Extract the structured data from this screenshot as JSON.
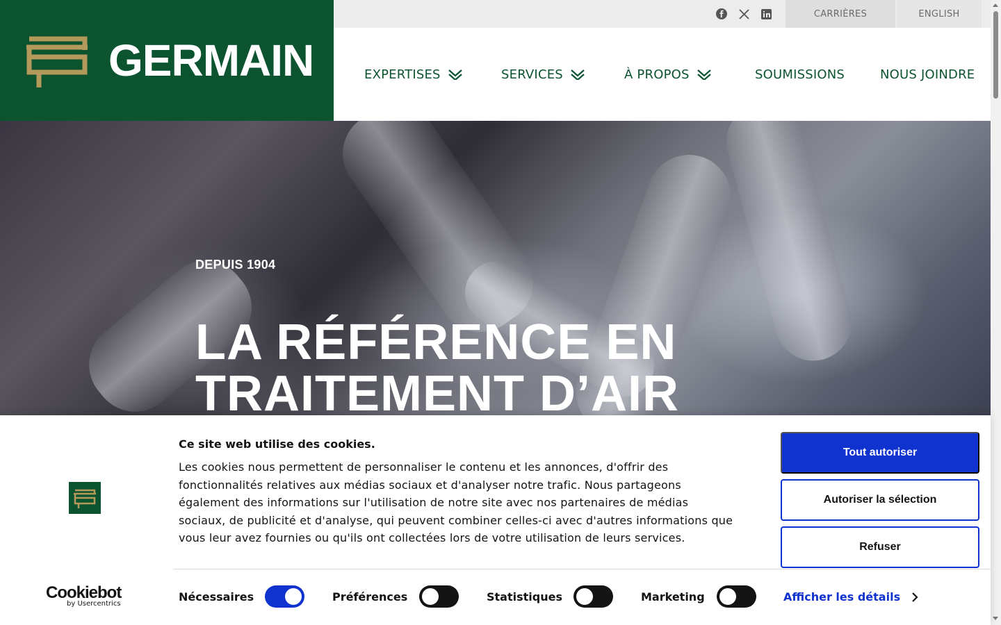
{
  "brand": {
    "name": "GERMAIN",
    "colors": {
      "green": "#0c5330",
      "gold": "#b49a5a",
      "cookie_blue": "#1032cf"
    }
  },
  "topbar": {
    "social": [
      "facebook-icon",
      "x-icon",
      "linkedin-icon"
    ],
    "careers": "CARRIÈRES",
    "language": "ENGLISH"
  },
  "nav": {
    "items": [
      {
        "label": "EXPERTISES",
        "has_dropdown": true
      },
      {
        "label": "SERVICES",
        "has_dropdown": true
      },
      {
        "label": "À PROPOS",
        "has_dropdown": true
      },
      {
        "label": "SOUMISSIONS",
        "has_dropdown": false
      },
      {
        "label": "NOUS JOINDRE",
        "has_dropdown": false
      }
    ]
  },
  "hero": {
    "eyebrow": "DEPUIS 1904",
    "title_line1": "LA RÉFÉRENCE EN",
    "title_line2": "TRAITEMENT D’AIR"
  },
  "cookie": {
    "title": "Ce site web utilise des cookies.",
    "body": "Les cookies nous permettent de personnaliser le contenu et les annonces, d'offrir des fonctionnalités relatives aux médias sociaux et d'analyser notre trafic. Nous partageons également des informations sur l'utilisation de notre site avec nos partenaires de médias sociaux, de publicité et d'analyse, qui peuvent combiner celles-ci avec d'autres informations que vous leur avez fournies ou qu'ils ont collectées lors de votre utilisation de leurs services.",
    "buttons": {
      "allow_all": "Tout autoriser",
      "allow_selection": "Autoriser la sélection",
      "deny": "Refuser"
    },
    "toggles": [
      {
        "label": "Nécessaires",
        "on": true
      },
      {
        "label": "Préférences",
        "on": false
      },
      {
        "label": "Statistiques",
        "on": false
      },
      {
        "label": "Marketing",
        "on": false
      }
    ],
    "details_link": "Afficher les détails",
    "provider": {
      "name": "Cookiebot",
      "sub": "by Usercentrics"
    }
  }
}
